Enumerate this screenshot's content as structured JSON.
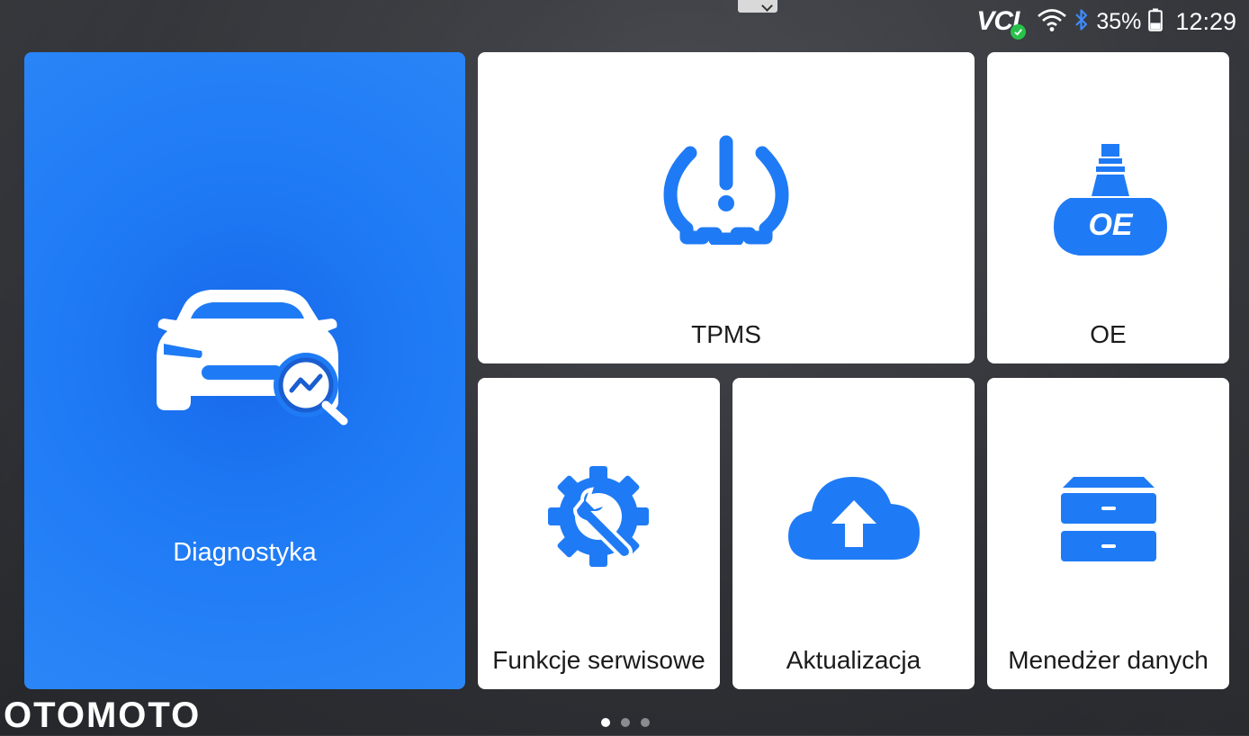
{
  "status_bar": {
    "vci_label": "VCI",
    "battery_percent": "35%",
    "time": "12:29"
  },
  "colors": {
    "accent_blue": "#1f7bf5",
    "tile_bg": "#ffffff",
    "status_ok": "#28c24a"
  },
  "tiles": {
    "diagnostics": {
      "label": "Diagnostyka",
      "icon": "car-search-icon"
    },
    "tpms": {
      "label": "TPMS",
      "icon": "tire-pressure-warning-icon"
    },
    "oe": {
      "label": "OE",
      "icon": "oe-tank-icon"
    },
    "service": {
      "label": "Funkcje serwisowe",
      "icon": "gear-wrench-icon"
    },
    "update": {
      "label": "Aktualizacja",
      "icon": "cloud-upload-icon"
    },
    "data_manager": {
      "label": "Menedżer danych",
      "icon": "drawer-cabinet-icon"
    }
  },
  "watermark": "OTOMOTO",
  "pager": {
    "pages": 3,
    "current": 1
  }
}
